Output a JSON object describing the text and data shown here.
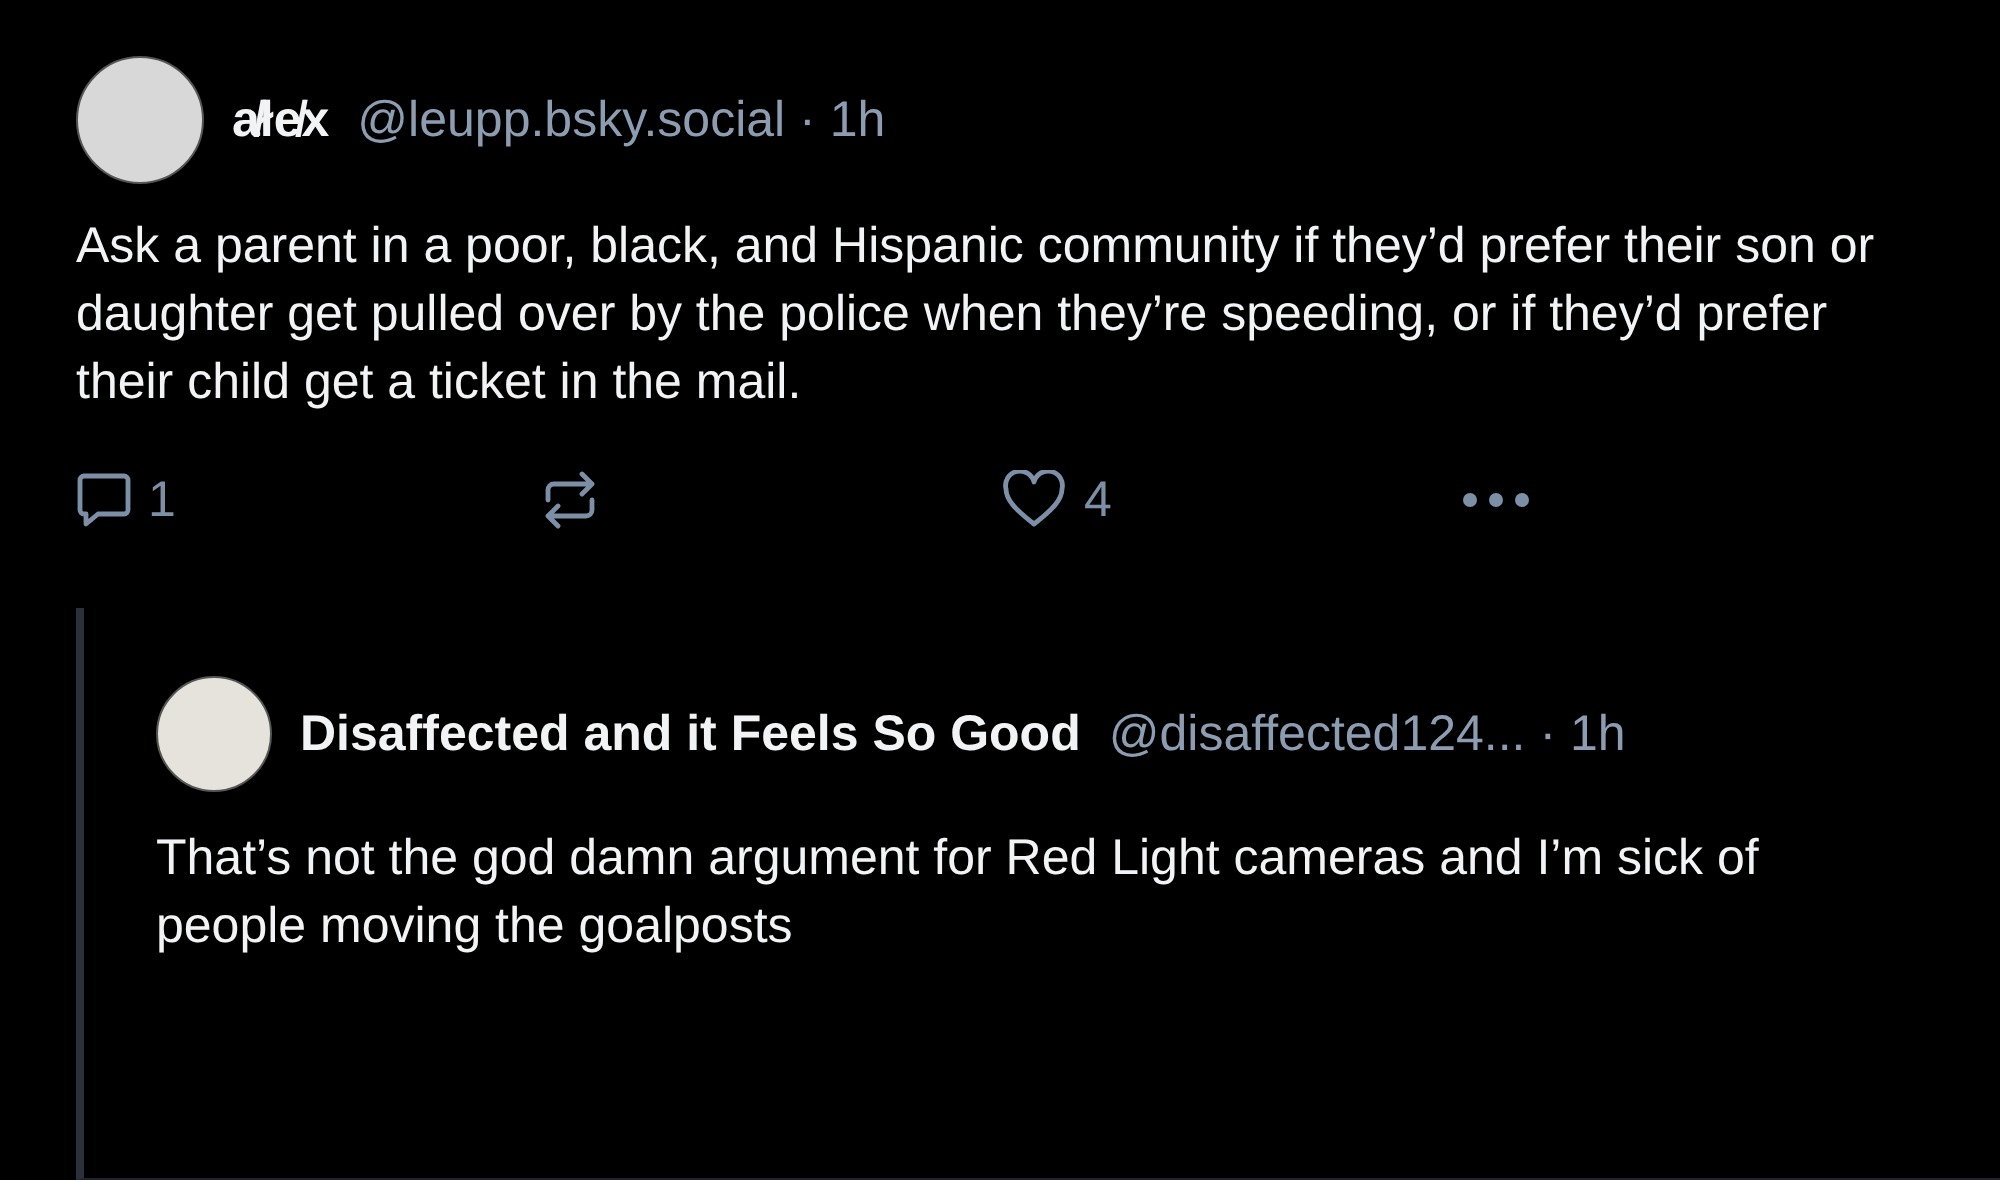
{
  "post": {
    "display_name": "a̸łe̸x",
    "handle": "@leupp.bsky.social",
    "separator": "·",
    "time": "1h",
    "text": "Ask a parent in a poor, black, and Hispanic community if they’d prefer their son or daughter get pulled over by the police when they’re speeding, or if they’d prefer their child get a ticket in the mail.",
    "actions": [
      {
        "kind": "reply",
        "count": "1"
      },
      {
        "kind": "repost"
      },
      {
        "kind": "like",
        "count": "4"
      },
      {
        "kind": "more"
      }
    ]
  },
  "reply": {
    "display_name": "Disaffected and it Feels So Good",
    "handle": "@disaffected124...",
    "separator": "·",
    "time": "1h",
    "text": "That’s not the god damn argument for Red Light cameras and I’m sick of people moving the goalposts"
  }
}
